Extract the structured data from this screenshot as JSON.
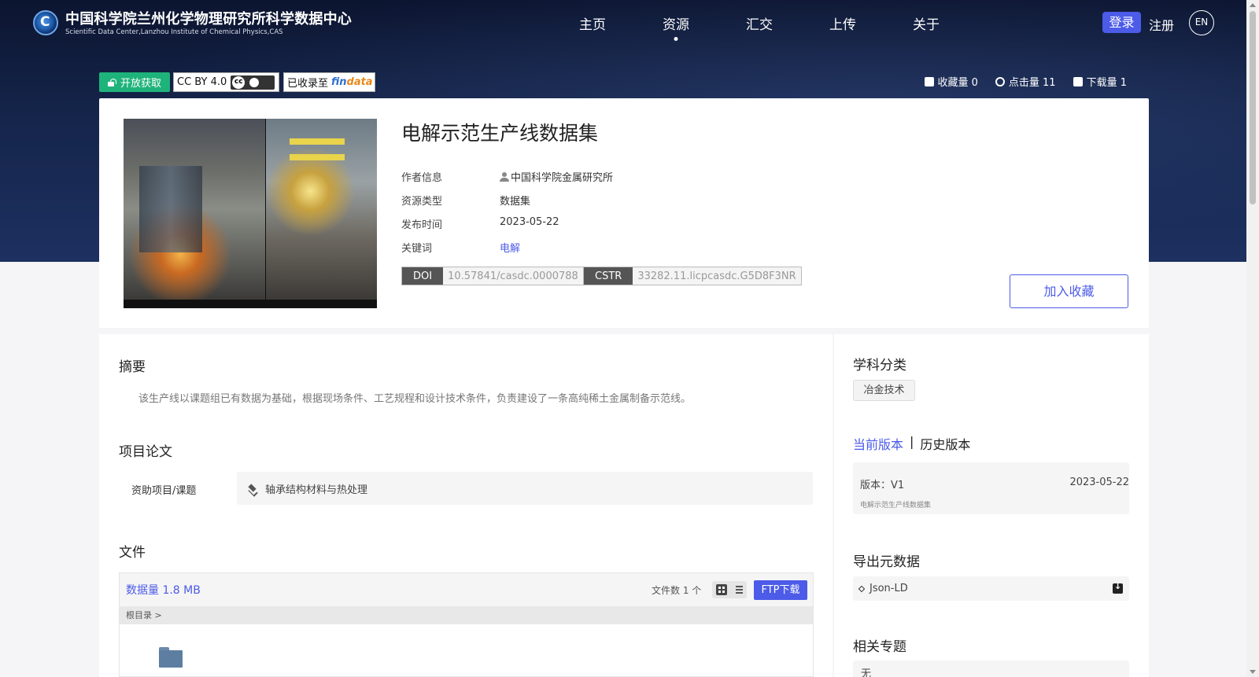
{
  "header": {
    "site_title": "中国科学院兰州化学物理研究所科学数据中心",
    "site_subtitle": "Scientific Data Center,Lanzhou Institute of Chemical Physics,CAS",
    "nav": [
      {
        "label": "主页"
      },
      {
        "label": "资源",
        "active": true
      },
      {
        "label": "汇交"
      },
      {
        "label": "上传"
      },
      {
        "label": "关于"
      }
    ],
    "login_label": "登录",
    "register_label": "注册",
    "lang_label": "EN"
  },
  "badges": {
    "open_access": "开放获取",
    "license": "CC BY 4.0",
    "indexed_prefix": "已收录至",
    "findata_logo": "findata"
  },
  "stats": {
    "favorites": "收藏量 0",
    "views": "点击量 11",
    "downloads": "下载量 1"
  },
  "dataset": {
    "title": "电解示范生产线数据集",
    "author_label": "作者信息",
    "author_value": "中国科学院金属研究所",
    "type_label": "资源类型",
    "type_value": "数据集",
    "date_label": "发布时间",
    "date_value": "2023-05-22",
    "keyword_label": "关键词",
    "keyword_value": "电解",
    "doi_tag": "DOI",
    "doi_value": "10.57841/casdc.0000788",
    "cstr_tag": "CSTR",
    "cstr_value": "33282.11.licpcasdc.G5D8F3NR",
    "favorite_button": "加入收藏"
  },
  "abstract": {
    "title": "摘要",
    "text": "该生产线以课题组已有数据为基础，根据现场条件、工艺规程和设计技术条件，负责建设了一条高纯稀土金属制备示范线。"
  },
  "project": {
    "title": "项目论文",
    "label": "资助项目/课题",
    "value": "轴承结构材料与热处理"
  },
  "files": {
    "title": "文件",
    "size": "数据量 1.8 MB",
    "count": "文件数 1 个",
    "ftp_button": "FTP下载",
    "breadcrumb": "根目录 >"
  },
  "sidebar": {
    "subject_title": "学科分类",
    "subject_tag": "冶金技术",
    "current_version_tab": "当前版本",
    "history_version_tab": "历史版本",
    "version_label": "版本：V1",
    "version_date": "2023-05-22",
    "version_name": "电解示范生产线数据集",
    "export_title": "导出元数据",
    "export_option": "Json-LD",
    "related_title": "相关专题",
    "related_value": "无"
  }
}
